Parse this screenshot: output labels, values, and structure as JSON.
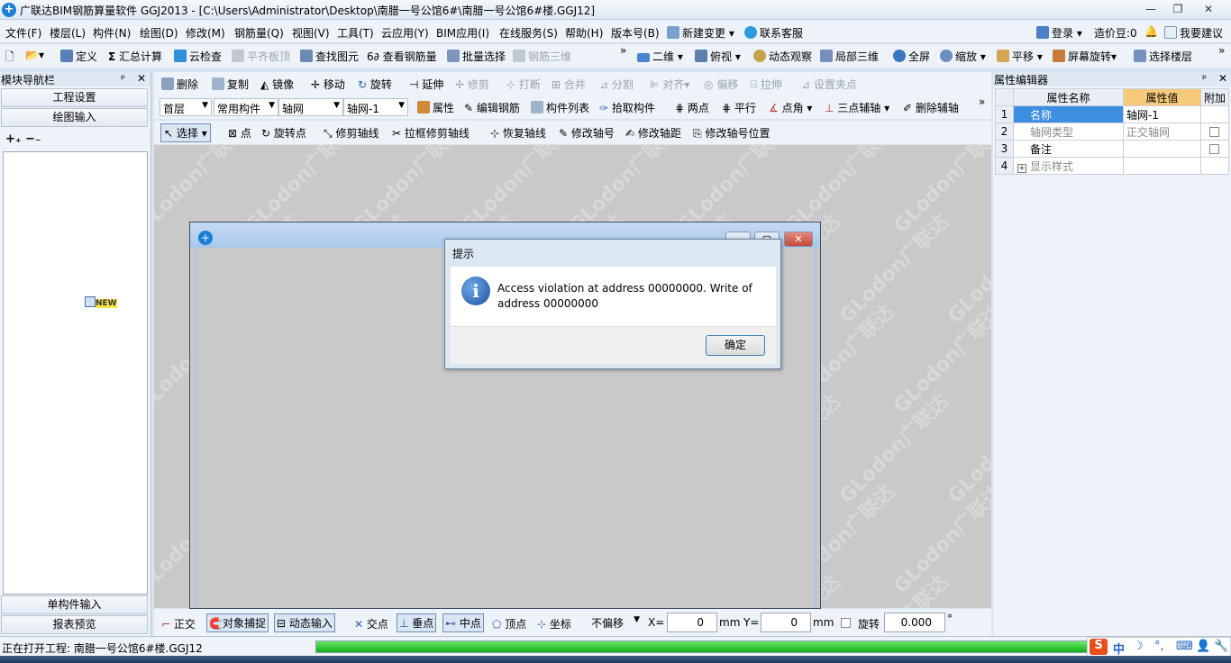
{
  "window": {
    "title": "广联达BIM钢筋算量软件 GGJ2013 - [C:\\Users\\Administrator\\Desktop\\南腊一号公馆6#\\南腊一号公馆6#楼.GGJ12]"
  },
  "menu": [
    "文件(F)",
    "楼层(L)",
    "构件(N)",
    "绘图(D)",
    "修改(M)",
    "钢筋量(Q)",
    "视图(V)",
    "工具(T)",
    "云应用(Y)",
    "BIM应用(I)",
    "在线服务(S)",
    "帮助(H)",
    "版本号(B)"
  ],
  "menu_right": {
    "new_change": "新建变更",
    "contact": "联系客服",
    "login": "登录",
    "beans": "造价豆:0",
    "suggest": "我要建议"
  },
  "toolbar1": [
    "定义",
    "汇总计算",
    "云检查",
    "平齐板顶",
    "查找图元",
    "查看钢筋量",
    "批量选择",
    "钢筋三维"
  ],
  "toolbar1_right": [
    "二维",
    "俯视",
    "动态观察",
    "局部三维",
    "全屏",
    "缩放",
    "平移",
    "屏幕旋转",
    "选择楼层"
  ],
  "toolbar2": [
    "删除",
    "复制",
    "镜像",
    "移动",
    "旋转",
    "延伸",
    "修剪",
    "打断",
    "合并",
    "分割",
    "对齐",
    "偏移",
    "拉伸",
    "设置夹点"
  ],
  "toolbar3": {
    "floor": "首层",
    "category": "常用构件",
    "type": "轴网",
    "instance": "轴网-1",
    "buttons": [
      "属性",
      "编辑钢筋",
      "构件列表",
      "拾取构件",
      "两点",
      "平行",
      "点角",
      "三点辅轴",
      "删除辅轴"
    ]
  },
  "toolbar4": [
    "选择",
    "点",
    "旋转点",
    "修剪轴线",
    "拉框修剪轴线",
    "恢复轴线",
    "修改轴号",
    "修改轴距",
    "修改轴号位置"
  ],
  "left_panel": {
    "title": "模块导航栏",
    "project_settings": "工程设置",
    "drawing_input": "绘图输入",
    "single_input": "单构件输入",
    "report_preview": "报表预览",
    "new_badge": "NEW"
  },
  "watermark": "GLodon广联达",
  "dialog": {
    "title": "提示",
    "message": "Access violation at address 00000000. Write of address 00000000",
    "ok": "确定"
  },
  "props": {
    "title": "属性编辑器",
    "headers": [
      "属性名称",
      "属性值",
      "附加"
    ],
    "rows": [
      {
        "n": "1",
        "name": "名称",
        "value": "轴网-1"
      },
      {
        "n": "2",
        "name": "轴网类型",
        "value": "正交轴网"
      },
      {
        "n": "3",
        "name": "备注",
        "value": ""
      },
      {
        "n": "4",
        "name": "显示样式",
        "value": ""
      }
    ]
  },
  "snap": {
    "items": [
      "正交",
      "对象捕捉",
      "动态输入",
      "交点",
      "垂点",
      "中点",
      "顶点",
      "坐标"
    ],
    "offset_mode": "不偏移",
    "x_label": "X=",
    "x": "0",
    "y_label": "Y=",
    "y": "0",
    "unit": "mm",
    "rotate_label": "旋转",
    "rotate": "0.000",
    "degree": "°"
  },
  "status": {
    "text": "正在打开工程: 南腊一号公馆6#楼.GGJ12",
    "progress": 1.0
  },
  "ime": [
    "中",
    "☽",
    "°,",
    "⌨",
    "👤",
    "🔧"
  ]
}
